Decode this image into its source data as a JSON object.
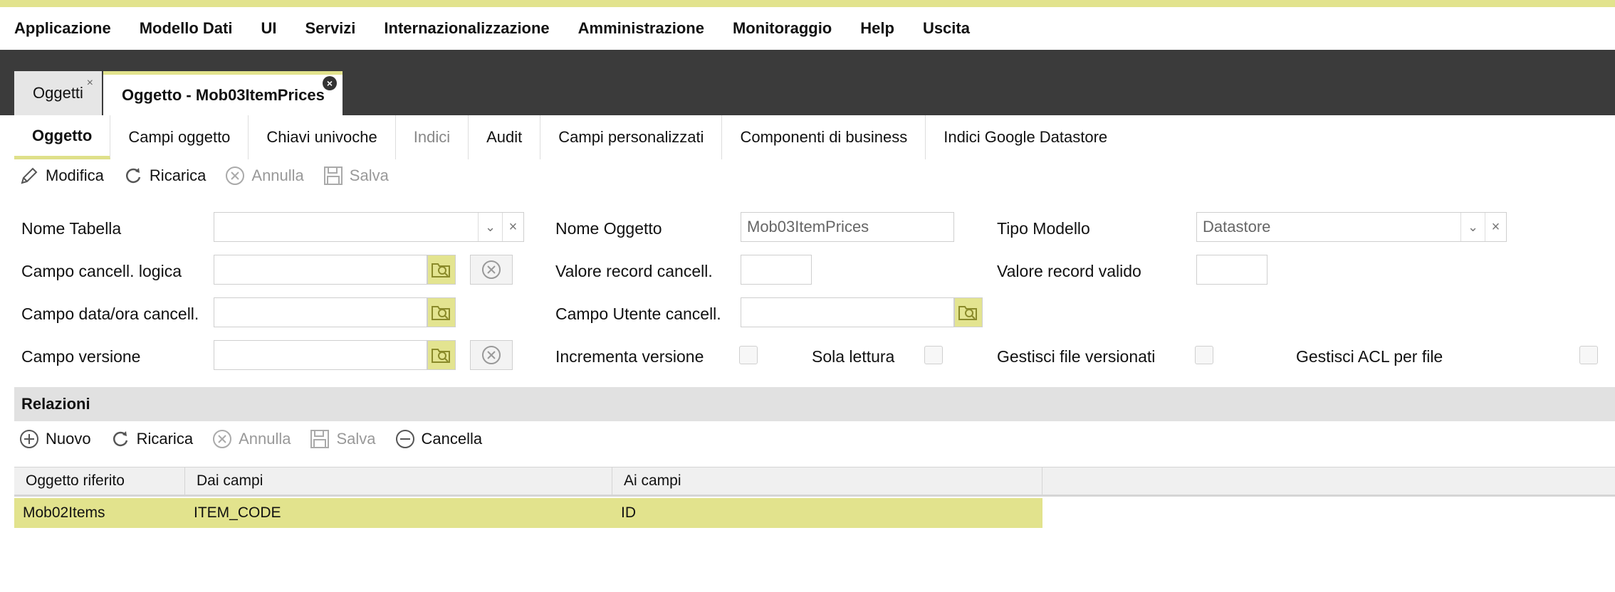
{
  "menu": [
    "Applicazione",
    "Modello Dati",
    "UI",
    "Servizi",
    "Internazionalizzazione",
    "Amministrazione",
    "Monitoraggio",
    "Help",
    "Uscita"
  ],
  "doc_tabs": [
    {
      "label": "Oggetti"
    },
    {
      "label": "Oggetto - Mob03ItemPrices"
    }
  ],
  "sub_tabs": [
    {
      "label": "Oggetto"
    },
    {
      "label": "Campi oggetto"
    },
    {
      "label": "Chiavi univoche"
    },
    {
      "label": "Indici"
    },
    {
      "label": "Audit"
    },
    {
      "label": "Campi personalizzati"
    },
    {
      "label": "Componenti di business"
    },
    {
      "label": "Indici Google Datastore"
    }
  ],
  "toolbar": {
    "modifica": "Modifica",
    "ricarica": "Ricarica",
    "annulla": "Annulla",
    "salva": "Salva"
  },
  "form": {
    "nome_tabella": {
      "label": "Nome Tabella",
      "value": ""
    },
    "nome_oggetto": {
      "label": "Nome Oggetto",
      "value": "Mob03ItemPrices"
    },
    "tipo_modello": {
      "label": "Tipo Modello",
      "value": "Datastore"
    },
    "campo_cancell_logica": {
      "label": "Campo cancell. logica",
      "value": ""
    },
    "valore_record_cancell": {
      "label": "Valore record cancell.",
      "value": ""
    },
    "valore_record_valido": {
      "label": "Valore record valido",
      "value": ""
    },
    "campo_data_ora_cancell": {
      "label": "Campo data/ora cancell.",
      "value": ""
    },
    "campo_utente_cancell": {
      "label": "Campo Utente cancell.",
      "value": ""
    },
    "campo_versione": {
      "label": "Campo versione",
      "value": ""
    },
    "incrementa_versione": {
      "label": "Incrementa versione",
      "checked": false
    },
    "sola_lettura": {
      "label": "Sola lettura",
      "checked": false
    },
    "gestisci_file_versionati": {
      "label": "Gestisci file versionati",
      "checked": false
    },
    "gestisci_acl_per_file": {
      "label": "Gestisci ACL per file",
      "checked": false
    }
  },
  "relazioni": {
    "title": "Relazioni",
    "toolbar": {
      "nuovo": "Nuovo",
      "ricarica": "Ricarica",
      "annulla": "Annulla",
      "salva": "Salva",
      "cancella": "Cancella"
    },
    "columns": [
      "Oggetto riferito",
      "Dai campi",
      "Ai campi"
    ],
    "rows": [
      [
        "Mob02Items",
        "ITEM_CODE",
        "ID"
      ]
    ]
  },
  "colors": {
    "accent": "#e2e38d",
    "dark_band": "#3b3b3b",
    "section_bg": "#e1e1e1"
  }
}
